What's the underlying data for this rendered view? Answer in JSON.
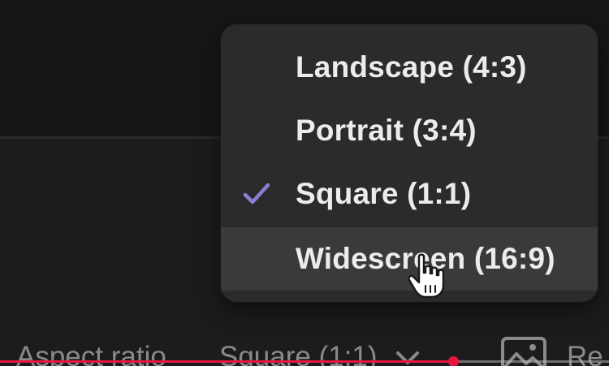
{
  "menu": {
    "items": [
      {
        "label": "Landscape (4:3)",
        "checked": false,
        "hovered": false
      },
      {
        "label": "Portrait (3:4)",
        "checked": false,
        "hovered": false
      },
      {
        "label": "Square (1:1)",
        "checked": true,
        "hovered": false
      },
      {
        "label": "Widescreen (16:9)",
        "checked": false,
        "hovered": true
      }
    ],
    "check_icon": "checkmark-icon",
    "check_color": "#8b7fd4"
  },
  "toolbar": {
    "aspect_label": "Aspect ratio",
    "aspect_value": "Square (1:1)",
    "chevron_icon": "chevron-down-icon",
    "image_icon": "image-icon",
    "reset_label": "Re"
  },
  "progress": {
    "fraction": 0.744,
    "color": "#e5173f"
  },
  "colors": {
    "menu_bg": "#2b2b2b",
    "menu_hover": "#3a3a3a",
    "text": "#ececec",
    "muted_text": "#8a8a8a"
  }
}
